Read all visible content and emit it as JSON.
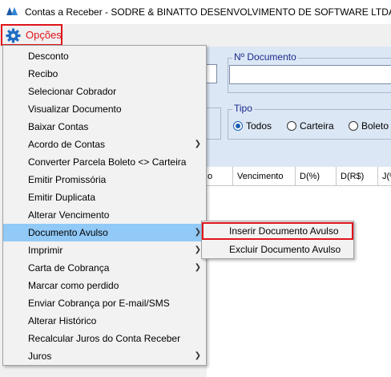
{
  "window": {
    "title": "Contas a Receber - SODRE & BINATTO DESENVOLVIMENTO DE SOFTWARE LTDA",
    "app_icon": "app-logo-icon"
  },
  "menubar": {
    "opcoes_label": "Opções",
    "opcoes_icon": "gear-icon",
    "highlight_color": "#e0141b"
  },
  "form": {
    "documento_label": "Nº Documento",
    "tipo_label": "Tipo",
    "tipo_options": [
      "Todos",
      "Carteira",
      "Boleto"
    ],
    "tipo_selected": "Todos"
  },
  "grid": {
    "columns": [
      "o",
      "Vencimento",
      "D(%)",
      "D(R$)",
      "J(%"
    ]
  },
  "dropdown": {
    "items": [
      {
        "label": "Desconto",
        "submenu": false
      },
      {
        "label": "Recibo",
        "submenu": false
      },
      {
        "label": "Selecionar Cobrador",
        "submenu": false
      },
      {
        "label": "Visualizar Documento",
        "submenu": false
      },
      {
        "label": "Baixar Contas",
        "submenu": false
      },
      {
        "label": "Acordo de Contas",
        "submenu": true
      },
      {
        "label": "Converter Parcela Boleto <> Carteira",
        "submenu": false
      },
      {
        "label": "Emitir Promissória",
        "submenu": false
      },
      {
        "label": "Emitir Duplicata",
        "submenu": false
      },
      {
        "label": "Alterar Vencimento",
        "submenu": false
      },
      {
        "label": "Documento Avulso",
        "submenu": true,
        "highlighted": true
      },
      {
        "label": "Imprimir",
        "submenu": true
      },
      {
        "label": "Carta de Cobrança",
        "submenu": true
      },
      {
        "label": "Marcar como perdido",
        "submenu": false
      },
      {
        "label": "Enviar Cobrança por E-mail/SMS",
        "submenu": false
      },
      {
        "label": "Alterar Histórico",
        "submenu": false
      },
      {
        "label": "Recalcular Juros do Conta Receber",
        "submenu": false
      },
      {
        "label": "Juros",
        "submenu": true
      }
    ],
    "highlight_color": "#91c9f7"
  },
  "submenu": {
    "items": [
      {
        "label": "Inserir Documento Avulso"
      },
      {
        "label": "Excluir Documento Avulso"
      }
    ]
  }
}
